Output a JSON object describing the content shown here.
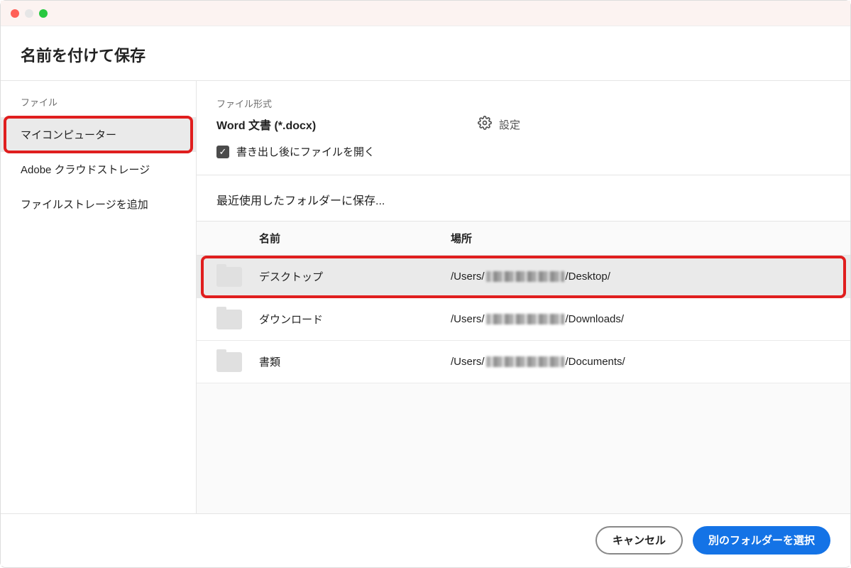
{
  "window": {
    "title": "名前を付けて保存"
  },
  "sidebar": {
    "section_label": "ファイル",
    "items": [
      {
        "label": "マイコンピューター",
        "selected": true,
        "highlighted": true
      },
      {
        "label": "Adobe クラウドストレージ",
        "selected": false,
        "highlighted": false
      },
      {
        "label": "ファイルストレージを追加",
        "selected": false,
        "highlighted": false
      }
    ]
  },
  "file_format": {
    "label": "ファイル形式",
    "value": "Word 文書 (*.docx)",
    "settings_label": "設定",
    "open_after_export_label": "書き出し後にファイルを開く",
    "open_after_export_checked": true
  },
  "recent": {
    "label": "最近使用したフォルダーに保存...",
    "columns": {
      "name": "名前",
      "path": "場所"
    },
    "rows": [
      {
        "name": "デスクトップ",
        "path_prefix": "/Users/",
        "path_suffix": "/Desktop/",
        "selected": true,
        "highlighted": true
      },
      {
        "name": "ダウンロード",
        "path_prefix": "/Users/",
        "path_suffix": "/Downloads/",
        "selected": false,
        "highlighted": false
      },
      {
        "name": "書類",
        "path_prefix": "/Users/",
        "path_suffix": "/Documents/",
        "selected": false,
        "highlighted": false
      }
    ]
  },
  "footer": {
    "cancel_label": "キャンセル",
    "choose_label": "別のフォルダーを選択"
  }
}
